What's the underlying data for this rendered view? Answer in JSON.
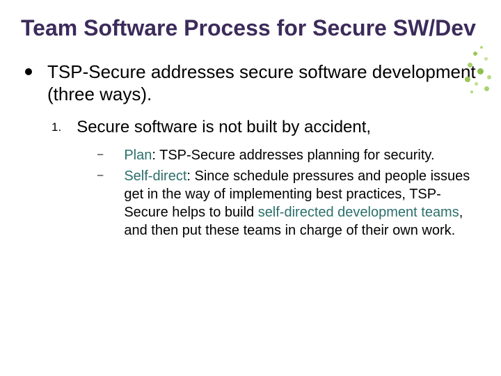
{
  "title": "Team Software Process for Secure SW/Dev",
  "lvl1_text": "TSP-Secure addresses secure software development (three ways).",
  "lvl2_num": "1.",
  "lvl2_text": "Secure software is not built by accident,",
  "plan_kw": "Plan",
  "plan_rest": ": TSP-Secure addresses planning for security.",
  "self_kw": "Self-direct",
  "self_pre": ": Since schedule pressures and people issues get in the way of implementing best practices, TSP-Secure helps to build ",
  "self_em": "self-directed development teams",
  "self_post": ", and then put these teams in charge of their own work.",
  "dash": "–"
}
